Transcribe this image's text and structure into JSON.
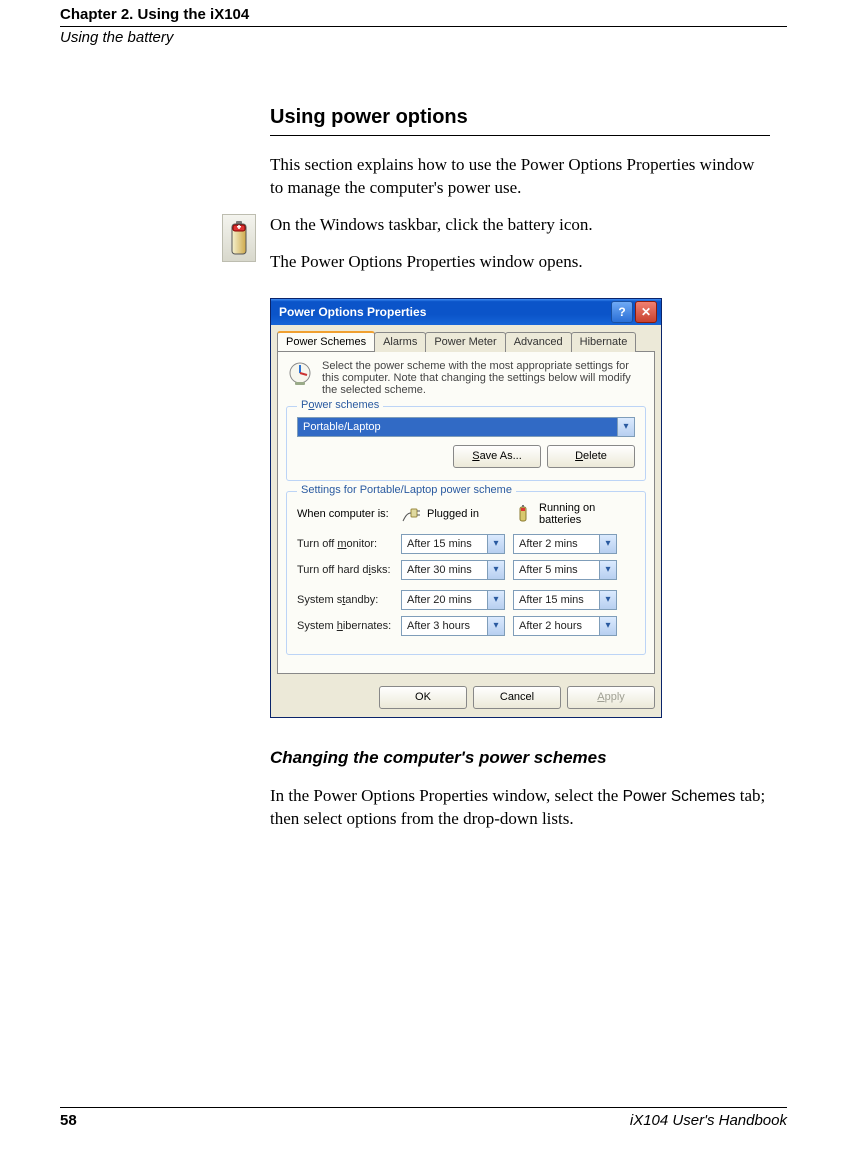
{
  "header": {
    "chapter": "Chapter 2. Using the iX104",
    "sub": "Using the battery"
  },
  "h2": "Using power options",
  "intro": "This section explains how to use the Power Options Properties window to manage the computer's power use.",
  "step1": "On the Windows taskbar, click the battery icon.",
  "step2": "The Power Options Properties window opens.",
  "window": {
    "title": "Power Options Properties",
    "help": "?",
    "close": "✕",
    "tabs": {
      "power_schemes": "Power Schemes",
      "alarms": "Alarms",
      "power_meter": "Power Meter",
      "advanced": "Advanced",
      "hibernate": "Hibernate"
    },
    "intro": "Select the power scheme with the most appropriate settings for this computer. Note that changing the settings below will modify the selected scheme.",
    "schemes_title": "Power schemes",
    "scheme_selected": "Portable/Laptop",
    "save_as": "Save As...",
    "delete": "Delete",
    "settings_title": "Settings for Portable/Laptop power scheme",
    "when_label": "When computer is:",
    "plugged_in": "Plugged in",
    "on_batteries": "Running on batteries",
    "rows": {
      "monitor_label": "Turn off monitor:",
      "monitor_ac": "After 15 mins",
      "monitor_dc": "After 2 mins",
      "hdd_label": "Turn off hard disks:",
      "hdd_ac": "After 30 mins",
      "hdd_dc": "After 5 mins",
      "standby_label": "System standby:",
      "standby_ac": "After 20 mins",
      "standby_dc": "After 15 mins",
      "hibernate_label": "System hibernates:",
      "hibernate_ac": "After 3 hours",
      "hibernate_dc": "After 2 hours"
    },
    "ok": "OK",
    "cancel": "Cancel",
    "apply": "Apply"
  },
  "h3": "Changing the computer's power schemes",
  "closing_a": "In the Power Options Properties window, select the",
  "closing_b": " Power Schemes ",
  "closing_c": "tab; then select options from the drop-down lists.",
  "footer": {
    "page": "58",
    "book": "iX104 User's Handbook"
  }
}
